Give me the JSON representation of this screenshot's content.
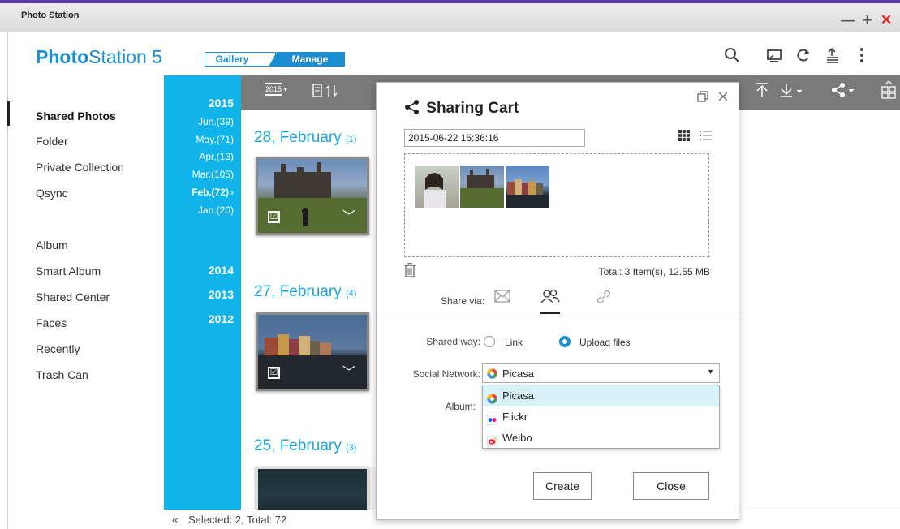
{
  "window": {
    "title": "Photo Station",
    "controls": {
      "minimize": "—",
      "maximize": "+",
      "close": "✕"
    }
  },
  "header": {
    "logo_bold": "Photo",
    "logo_rest": "Station 5",
    "modes": {
      "gallery": "Gallery",
      "manage": "Manage"
    },
    "icons": [
      "search-icon",
      "cast-icon",
      "refresh-icon",
      "upload-queue-icon",
      "more-icon"
    ]
  },
  "sidebar": {
    "items": [
      "Shared Photos",
      "Folder",
      "Private Collection",
      "Qsync",
      "Album",
      "Smart Album",
      "Shared Center",
      "Faces",
      "Recently",
      "Trash Can"
    ],
    "active": "Shared Photos"
  },
  "timeline": {
    "years": [
      "2015",
      "2014",
      "2013",
      "2012"
    ],
    "months_2015": [
      "Jun.(39)",
      "May.(71)",
      "Apr.(13)",
      "Mar.(105)",
      "Feb.(72)",
      "Jan.(20)"
    ],
    "selected_month": "Feb.(72)",
    "selected_arrow": "›"
  },
  "toolbar": {
    "year_filter_label": "2015",
    "icons": [
      "year-filter-icon",
      "sort-icon",
      "upload-icon",
      "download-icon",
      "share-icon",
      "view-mode-icon"
    ]
  },
  "content": {
    "groups": [
      {
        "date": "28, February",
        "count": "(1)"
      },
      {
        "date": "27, February",
        "count": "(4)"
      },
      {
        "date": "25, February",
        "count": "(3)"
      }
    ],
    "check_mark": "☑",
    "chevron": "﹀"
  },
  "status": {
    "collapse": "«",
    "text": "Selected: 2, Total: 72"
  },
  "dialog": {
    "title": "Sharing Cart",
    "cart_name": "2015-06-22 16:36:16",
    "total": "Total: 3 Item(s), 12.55 MB",
    "share_via_label": "Share via:",
    "share_options": [
      "email-share-icon",
      "social-share-icon",
      "link-share-icon"
    ],
    "active_share_option": "social-share-icon",
    "shared_way_label": "Shared way:",
    "shared_way_options": [
      "Link",
      "Upload files"
    ],
    "shared_way_selected": "Upload files",
    "social_network_label": "Social Network:",
    "social_network_value": "Picasa",
    "social_network_options": [
      "Picasa",
      "Flickr",
      "Weibo"
    ],
    "album_label": "Album:",
    "buttons": {
      "create": "Create",
      "close": "Close"
    }
  },
  "colors": {
    "accent": "#1a8ed0",
    "timeline": "#11b4ea",
    "toolbar": "#7a7a7a",
    "close_red": "#e0201b",
    "title_stripe": "#5b3aa0"
  }
}
